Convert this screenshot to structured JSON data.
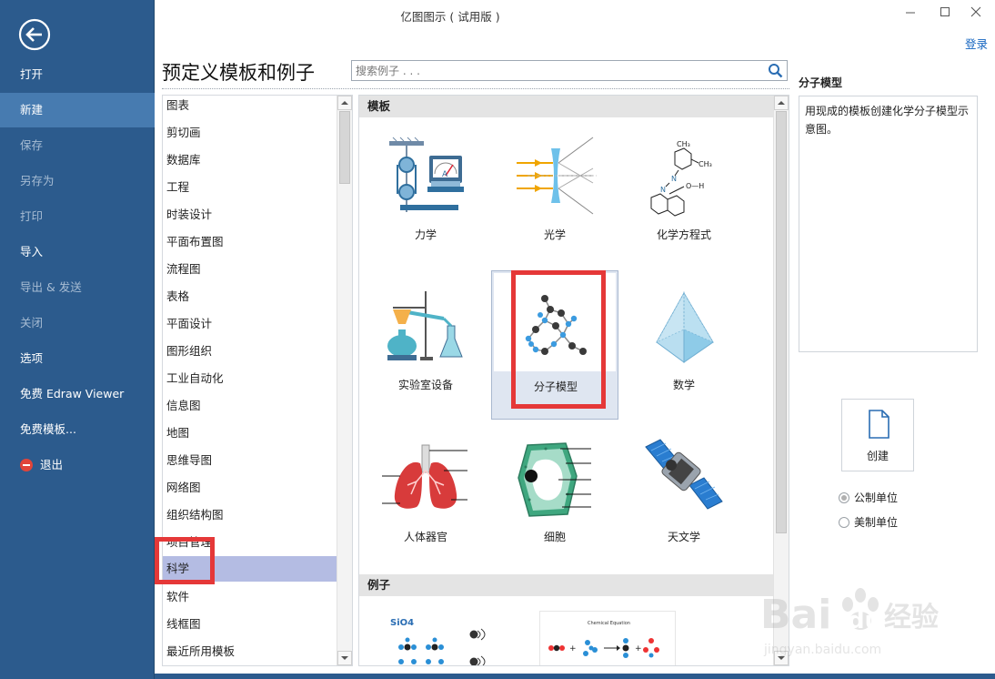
{
  "window": {
    "title": "亿图图示 ( 试用版 )",
    "login": "登录",
    "controls": [
      "minimize-icon",
      "maximize-icon",
      "close-icon"
    ]
  },
  "sidebar": {
    "back_icon": "back-arrow-icon",
    "items": [
      {
        "label": "打开",
        "state": "enabled"
      },
      {
        "label": "新建",
        "state": "active"
      },
      {
        "label": "保存",
        "state": "disabled"
      },
      {
        "label": "另存为",
        "state": "disabled"
      },
      {
        "label": "打印",
        "state": "disabled"
      },
      {
        "label": "导入",
        "state": "enabled"
      },
      {
        "label": "导出 & 发送",
        "state": "disabled"
      },
      {
        "label": "关闭",
        "state": "disabled"
      },
      {
        "label": "选项",
        "state": "enabled"
      },
      {
        "label": "免费 Edraw Viewer",
        "state": "enabled"
      },
      {
        "label": "免费模板...",
        "state": "enabled"
      },
      {
        "label": "退出",
        "state": "enabled",
        "icon": "exit-icon"
      }
    ]
  },
  "main": {
    "title": "预定义模板和例子",
    "search": {
      "placeholder": "搜索例子 . . .",
      "value": "",
      "icon": "search-icon"
    }
  },
  "categories": {
    "selected": "科学",
    "items": [
      "图表",
      "剪切画",
      "数据库",
      "工程",
      "时装设计",
      "平面布置图",
      "流程图",
      "表格",
      "平面设计",
      "图形组织",
      "工业自动化",
      "信息图",
      "地图",
      "思维导图",
      "网络图",
      "组织结构图",
      "项目管理",
      "科学",
      "软件",
      "线框图",
      "最近所用模板"
    ]
  },
  "gallery": {
    "templates_header": "模板",
    "examples_header": "例子",
    "selected": "分子模型",
    "templates": [
      {
        "label": "力学",
        "icon": "mechanics-icon"
      },
      {
        "label": "光学",
        "icon": "optics-icon"
      },
      {
        "label": "化学方程式",
        "icon": "chemical-formula-icon"
      },
      {
        "label": "实验室设备",
        "icon": "lab-equipment-icon"
      },
      {
        "label": "分子模型",
        "icon": "molecule-model-icon"
      },
      {
        "label": "数学",
        "icon": "pyramid-icon"
      },
      {
        "label": "人体器官",
        "icon": "lungs-icon"
      },
      {
        "label": "细胞",
        "icon": "cell-icon"
      },
      {
        "label": "天文学",
        "icon": "satellite-icon"
      }
    ],
    "examples": [
      {
        "caption": "SiO4",
        "icon": "sio4-example-icon"
      },
      {
        "caption": "Chemical Equation",
        "icon": "chemical-equation-example-icon"
      }
    ],
    "mechanics_meter_letter": "A",
    "formula_labels": {
      "ch3_top": "CH₃",
      "ch3_right": "CH₃",
      "oh": "O—H",
      "n1": "N",
      "n2": "N"
    }
  },
  "details": {
    "title": "分子模型",
    "description": "用现成的模板创建化学分子模型示意图。",
    "create_label": "创建",
    "units": [
      {
        "label": "公制单位",
        "checked": true
      },
      {
        "label": "美制单位",
        "checked": false
      }
    ]
  },
  "watermark": {
    "brand": "Bai",
    "brand2": "du",
    "cn": "经验",
    "url": "jingyan.baidu.com"
  },
  "colors": {
    "sidebar": "#2c5b8d",
    "sidebar_active": "#477bb0",
    "selection": "#b4bce3",
    "highlight_box": "#e53838",
    "link": "#1565c0"
  }
}
